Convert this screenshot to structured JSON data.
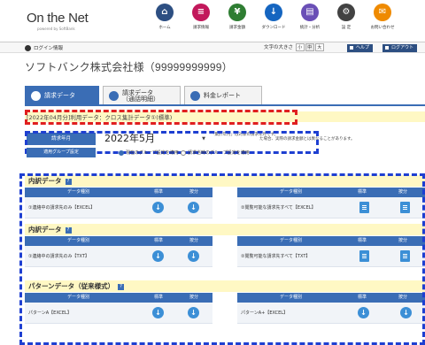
{
  "header": {
    "logo": "On the Net",
    "logo_sub": "powered by SoftBank",
    "nav": [
      {
        "label": "ホーム",
        "icon": "home-icon",
        "color": "#2d4f82",
        "glyph": "⌂"
      },
      {
        "label": "請求情報",
        "icon": "invoice-icon",
        "color": "#c2185b",
        "glyph": "≡"
      },
      {
        "label": "請求金額",
        "icon": "yen-icon",
        "color": "#2e7d32",
        "glyph": "¥"
      },
      {
        "label": "ダウンロード",
        "icon": "download-icon",
        "color": "#1565c0",
        "glyph": "↓",
        "active": true
      },
      {
        "label": "統計・分析",
        "icon": "stats-icon",
        "color": "#6a4fb6",
        "glyph": "▤"
      },
      {
        "label": "設 定",
        "icon": "settings-icon",
        "color": "#424242",
        "glyph": "⚙"
      },
      {
        "label": "お問い合わせ",
        "icon": "contact-icon",
        "color": "#ef8a00",
        "glyph": "✉"
      }
    ]
  },
  "userbar": {
    "login_info": "ログイン情報",
    "fontsize_label": "文字の大きさ",
    "fontsize_options": [
      "小",
      "中",
      "大"
    ],
    "help_label": "ヘルプ",
    "logout_label": "ログアウト"
  },
  "customer_name": "ソフトバンク株式会社様（99999999999）",
  "tabs": [
    {
      "label": "請求データ",
      "active": true
    },
    {
      "label": "請求データ\n（通話明細）",
      "active": false
    },
    {
      "label": "料金レポート",
      "active": false
    }
  ],
  "period_text": "[2022年04月分]利用データ：クロス集計データ①(標準)",
  "month_row": {
    "label": "請求年月",
    "value": "2022年5月",
    "note": "「集計年月」は対象の請求年月です。",
    "note2": "た場合、実際の請求金額とは異なることがあります。"
  },
  "group_row": {
    "label": "適用グループ設定",
    "option1": "現在のグループ設定を適用",
    "option2": "請求当時のグループ設定を適用"
  },
  "table_headers": {
    "type": "データ種別",
    "standard": "標準",
    "by_account": "按分"
  },
  "sections": [
    {
      "title": "内訳データ",
      "left": [
        {
          "name": "①連絡中の請求先のみ【EXCEL】"
        }
      ],
      "right": [
        {
          "name": "②閲覧可能な請求先すべて【EXCEL】"
        }
      ]
    },
    {
      "title": "内訳データ",
      "left": [
        {
          "name": "①連絡中の請求先のみ【TXT】"
        }
      ],
      "right": [
        {
          "name": "②閲覧可能な請求先すべて【TXT】"
        }
      ]
    },
    {
      "title": "パターンデータ（従来様式）",
      "left": [
        {
          "name": "パターンA【EXCEL】"
        }
      ],
      "right": [
        {
          "name": "パターンA+【EXCEL】"
        }
      ]
    }
  ]
}
